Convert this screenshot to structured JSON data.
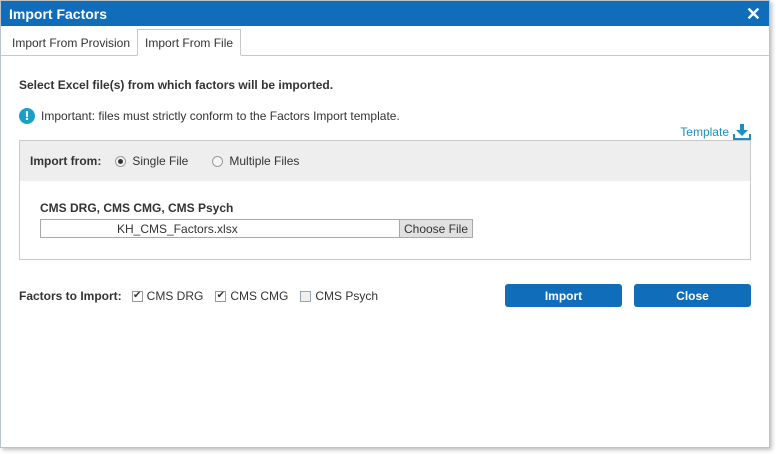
{
  "window": {
    "title": "Import Factors",
    "close_glyph": "✕"
  },
  "tabs": [
    {
      "label": "Import From Provision",
      "active": false
    },
    {
      "label": "Import From File",
      "active": true
    }
  ],
  "main": {
    "heading": "Select Excel file(s) from which factors will be imported.",
    "notice": "Important: files must strictly conform to the Factors Import template.",
    "template_link": "Template",
    "import_from": {
      "label": "Import from:",
      "options": [
        {
          "label": "Single File",
          "selected": true
        },
        {
          "label": "Multiple Files",
          "selected": false
        }
      ]
    },
    "file": {
      "label": "CMS DRG, CMS CMG, CMS Psych",
      "value": "KH_CMS_Factors.xlsx",
      "button": "Choose File"
    },
    "factors": {
      "label": "Factors to Import:",
      "items": [
        {
          "label": "CMS DRG",
          "checked": true
        },
        {
          "label": "CMS CMG",
          "checked": true
        },
        {
          "label": "CMS Psych",
          "checked": false
        }
      ]
    },
    "buttons": {
      "import": "Import",
      "close": "Close"
    }
  },
  "colors": {
    "accent": "#0f6db9",
    "link": "#1a8fc4",
    "info": "#1aa0c8"
  }
}
